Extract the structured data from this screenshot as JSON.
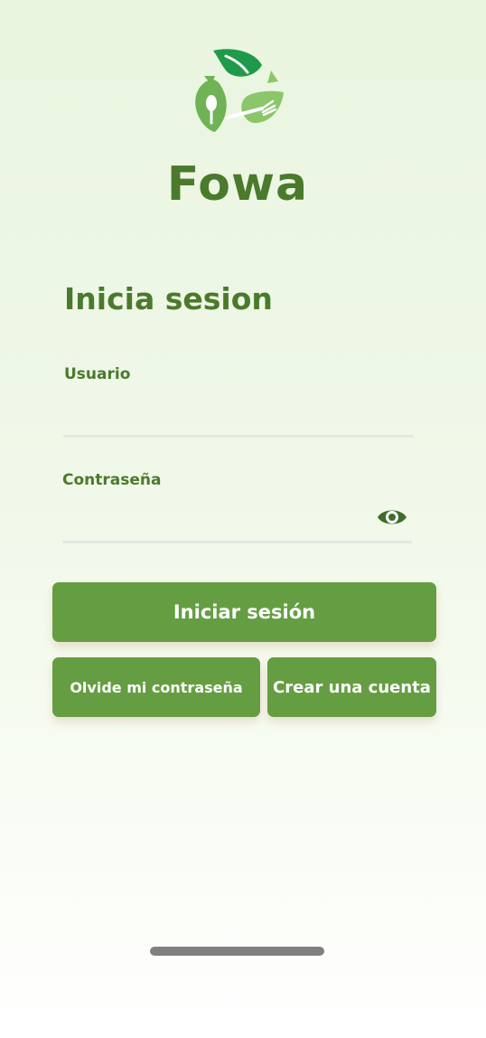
{
  "app": {
    "title": "Fowa"
  },
  "login": {
    "heading": "Inicia sesion",
    "username_label": "Usuario",
    "username_value": "",
    "password_label": "Contraseña",
    "password_value": ""
  },
  "buttons": {
    "sign_in": "Iniciar sesión",
    "forgot_password": "Olvide mi contraseña",
    "create_account": "Crear una cuenta"
  },
  "icons": {
    "logo": "recycle-leaves-utensils-logo",
    "password_toggle": "eye-icon"
  },
  "colors": {
    "primary_green": "#659e42",
    "title_green": "#4a7a2c",
    "logo_dark_green": "#1f9a4a",
    "logo_light_green": "#8cc66a"
  }
}
